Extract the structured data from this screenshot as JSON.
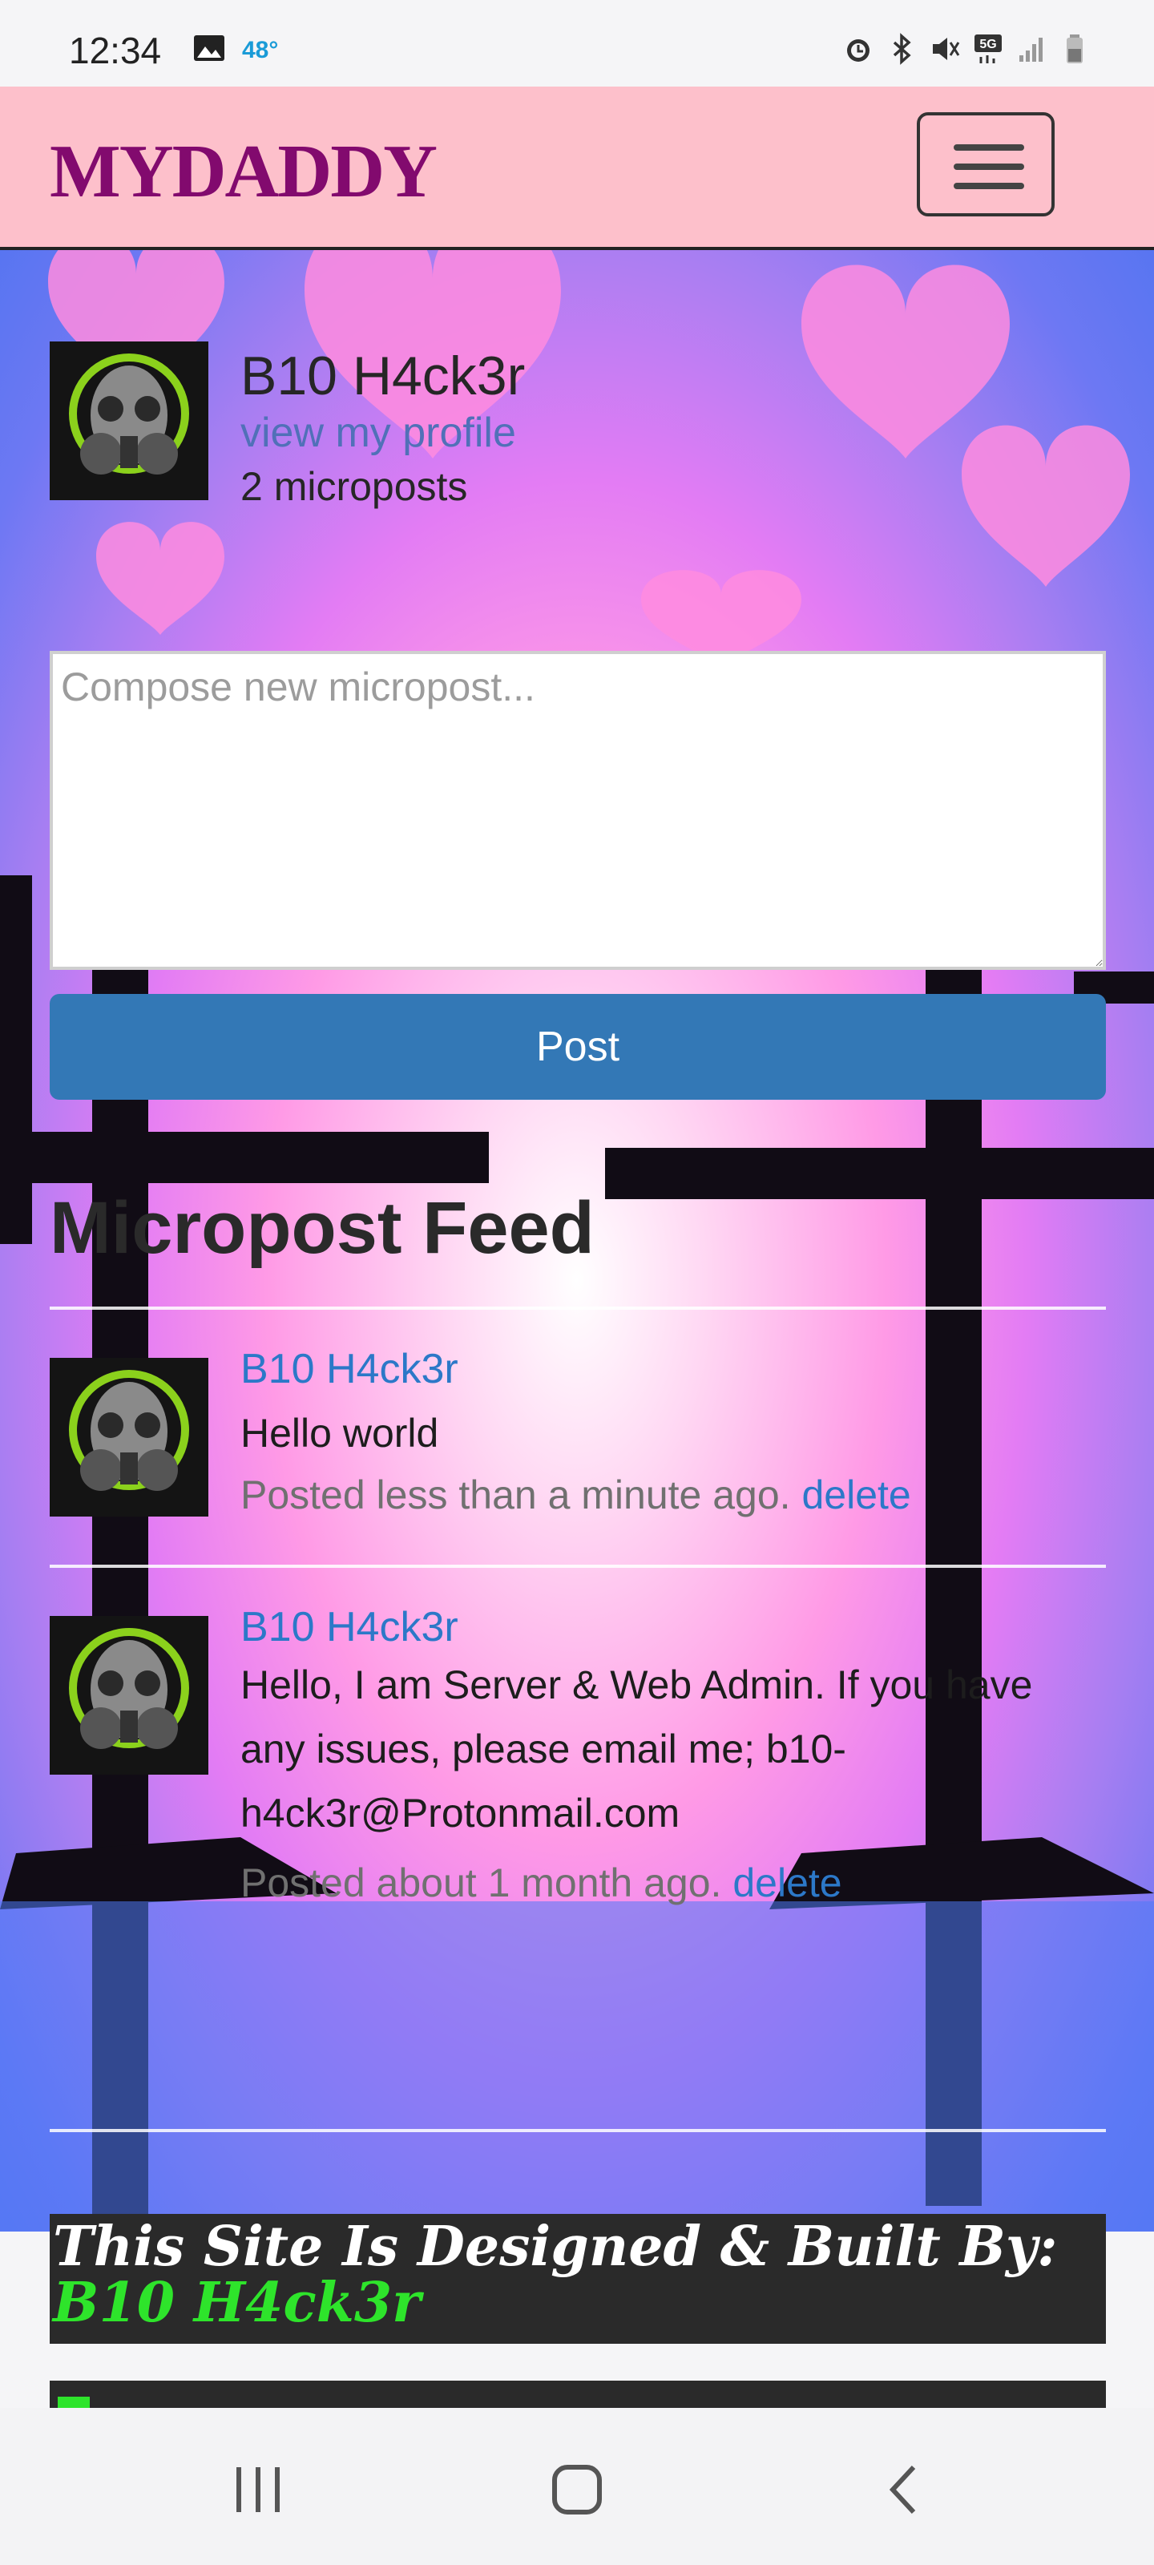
{
  "status_bar": {
    "time": "12:34",
    "temperature": "48°",
    "icons": [
      "gallery-icon",
      "alarm-icon",
      "bluetooth-icon",
      "mute-icon",
      "5g-icon",
      "signal-icon",
      "battery-icon"
    ]
  },
  "navbar": {
    "brand": "MYDADDY",
    "menu_icon": "hamburger-icon",
    "colors": {
      "background": "#fdc0cb",
      "brand": "#820a6e"
    }
  },
  "profile": {
    "name": "B10 H4ck3r",
    "link": "view my profile",
    "count": "2 microposts"
  },
  "compose": {
    "placeholder": "Compose new micropost...",
    "value": "",
    "submit_label": "Post",
    "button_color": "#3378b6"
  },
  "feed": {
    "title": "Micropost Feed",
    "posts": [
      {
        "user": "B10 H4ck3r",
        "content": "Hello world",
        "time": "Posted less than a minute ago.",
        "delete": "delete"
      },
      {
        "user": "B10 H4ck3r",
        "content": "Hello, I am Server & Web Admin. If you have any issues, please email me; b10-h4ck3r@Protonmail.com",
        "time": "Posted about 1 month ago.",
        "delete": "delete"
      }
    ]
  },
  "footer": {
    "credit": "This Site Is Designed & Built By: ",
    "author": "B10 H4ck3r",
    "accent": "#2ee42b"
  },
  "system_nav": [
    "recent-apps-icon",
    "home-icon",
    "back-icon"
  ]
}
